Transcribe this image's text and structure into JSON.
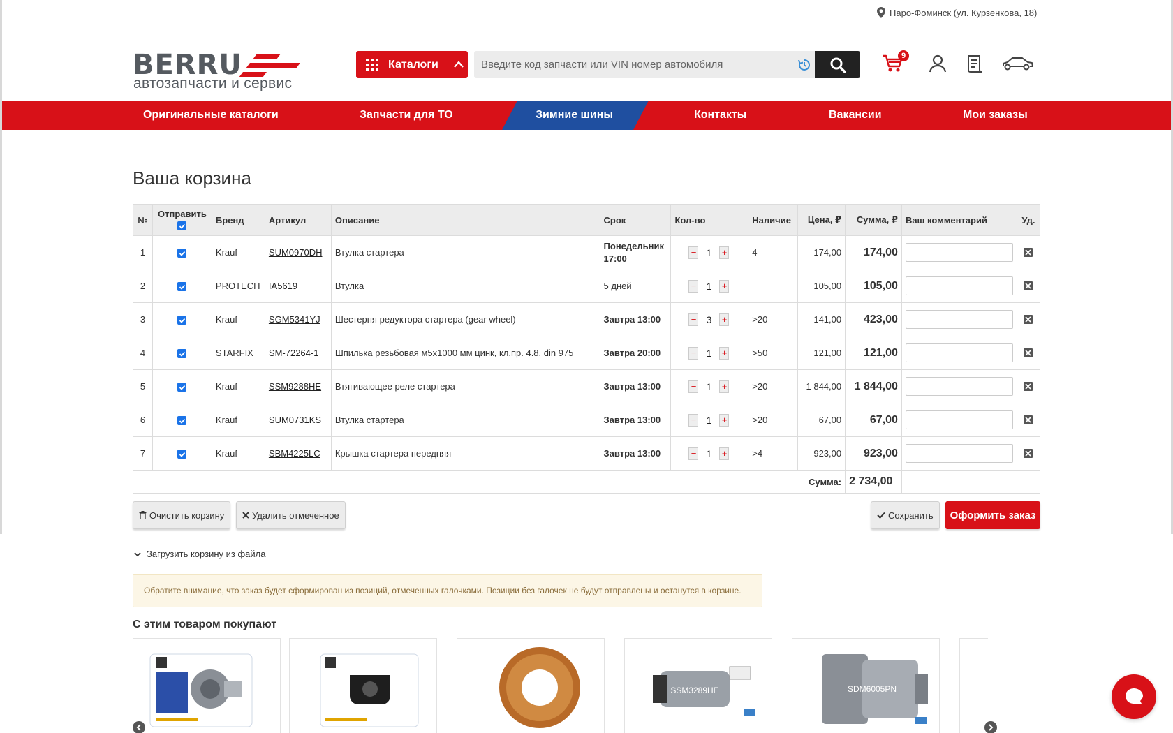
{
  "location": "Наро-Фоминск (ул. Курзенкова, 18)",
  "logo": {
    "word": "BERRU",
    "subtitle": "автозапчасти и сервис"
  },
  "header": {
    "catalog_label": "Каталоги",
    "search_placeholder": "Введите код запчасти или VIN номер автомобиля",
    "cart_count": "9"
  },
  "nav": [
    {
      "label": "Оригинальные каталоги"
    },
    {
      "label": "Запчасти для ТО"
    },
    {
      "label": "Зимние шины"
    },
    {
      "label": "Контакты"
    },
    {
      "label": "Вакансии"
    },
    {
      "label": "Мои заказы"
    }
  ],
  "page_title": "Ваша корзина",
  "table": {
    "headers": {
      "num": "№",
      "send": "Отправить",
      "brand": "Бренд",
      "article": "Артикул",
      "desc": "Описание",
      "term": "Срок",
      "qty": "Кол-во",
      "avail": "Наличие",
      "price": "Цена, ₽",
      "sum": "Сумма, ₽",
      "comment": "Ваш комментарий",
      "del": "Уд."
    },
    "rows": [
      {
        "num": "1",
        "brand": "Krauf",
        "article": "SUM0970DH",
        "desc": "Втулка стартера",
        "term": "Понедельник 17:00",
        "term_bold": true,
        "qty": "1",
        "avail": "4",
        "price": "174,00",
        "sum": "174,00"
      },
      {
        "num": "2",
        "brand": "PROTECH",
        "article": "IA5619",
        "desc": "Втулка",
        "term": "5 дней",
        "term_bold": false,
        "qty": "1",
        "avail": "",
        "price": "105,00",
        "sum": "105,00"
      },
      {
        "num": "3",
        "brand": "Krauf",
        "article": "SGM5341YJ",
        "desc": "Шестерня редуктора стартера (gear wheel)",
        "term": "Завтра 13:00",
        "term_bold": true,
        "qty": "3",
        "avail": ">20",
        "price": "141,00",
        "sum": "423,00"
      },
      {
        "num": "4",
        "brand": "STARFIX",
        "article": "SM-72264-1",
        "desc": "Шпилька резьбовая м5х1000 мм цинк, кл.пр. 4.8, din 975",
        "term": "Завтра 20:00",
        "term_bold": true,
        "qty": "1",
        "avail": ">50",
        "price": "121,00",
        "sum": "121,00"
      },
      {
        "num": "5",
        "brand": "Krauf",
        "article": "SSM9288HE",
        "desc": "Втягивающее реле стартера",
        "term": "Завтра 13:00",
        "term_bold": true,
        "qty": "1",
        "avail": ">20",
        "price": "1 844,00",
        "sum": "1 844,00"
      },
      {
        "num": "6",
        "brand": "Krauf",
        "article": "SUM0731KS",
        "desc": "Втулка стартера",
        "term": "Завтра 13:00",
        "term_bold": true,
        "qty": "1",
        "avail": ">20",
        "price": "67,00",
        "sum": "67,00"
      },
      {
        "num": "7",
        "brand": "Krauf",
        "article": "SBM4225LC",
        "desc": "Крышка стартера передняя",
        "term": "Завтра 13:00",
        "term_bold": true,
        "qty": "1",
        "avail": ">4",
        "price": "923,00",
        "sum": "923,00"
      }
    ],
    "total_label": "Сумма:",
    "total_value": "2 734,00"
  },
  "buttons": {
    "clear": "Очистить корзину",
    "delete_marked": "Удалить отмеченное",
    "save": "Сохранить",
    "checkout": "Оформить заказ"
  },
  "load_link": "Загрузить корзину из файла",
  "notice": "Обратите внимание, что заказ будет сформирован из позиций, отмеченных галочками. Позиции без галочек не будут отправлены и останутся в корзине.",
  "also_title": "С этим товаром покупают",
  "products": [
    {
      "label": ""
    },
    {
      "label": ""
    },
    {
      "label": ""
    },
    {
      "label": "SSM3289HE"
    },
    {
      "label": "SDM6005PN"
    }
  ],
  "colors": {
    "brand_red": "#d81118",
    "nav_blue": "#1f4fa0",
    "checkbox_blue": "#1a73e8"
  }
}
